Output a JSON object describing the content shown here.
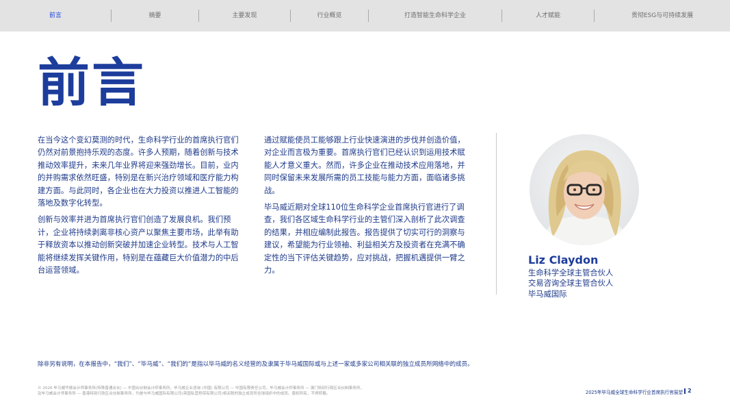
{
  "nav": {
    "items": [
      {
        "label": "前言",
        "active": true
      },
      {
        "label": "摘要"
      },
      {
        "label": "主要发现"
      },
      {
        "label": "行业概览"
      },
      {
        "label": "打造智能生命科学企业"
      },
      {
        "label": "人才赋能"
      },
      {
        "label": "贯彻ESG与可持续发展"
      }
    ]
  },
  "title": "前言",
  "col1": {
    "p1": "在当今这个变幻莫测的时代，生命科学行业的首席执行官们仍然对前景抱持乐观的态度。许多人预期，随着创新与技术推动效率提升，未来几年业界将迎来强劲增长。目前，业内的并购需求依然旺盛，特别是在新兴治疗领域和医疗能力构建方面。与此同时，各企业也在大力投资以推进人工智能的落地及数字化转型。",
    "p2": "创新与效率并进为首席执行官们创造了发展良机。我们预计，企业将持续剥离非核心资产以聚焦主要市场，此举有助于释放资本以推动创新突破并加速企业转型。技术与人工智能将继续发挥关键作用，特别是在蕴藏巨大价值潜力的中后台运营领域。"
  },
  "col2": {
    "p1": "通过赋能使员工能够跟上行业快速演进的步伐并创造价值，对企业而言极为重要。首席执行官们已经认识到运用技术赋能人才意义重大。然而，许多企业在推动技术应用落地，并同时保留未来发展所需的员工技能与能力方面，面临诸多挑战。",
    "p2": "毕马威近期对全球110位生命科学企业首席执行官进行了调查，我们各区域生命科学行业的主管们深入剖析了此次调查的结果，并相应编制此报告。报告提供了切实可行的洞察与建议，希望能为行业领袖、利益相关方及投资者在充满不确定性的当下评估关键趋势，应对挑战，把握机遇提供一臂之力。"
  },
  "person": {
    "name": "Liz Claydon",
    "role1": "生命科学全球主管合伙人",
    "role2": "交易咨询全球主管合伙人",
    "role3": "毕马威国际"
  },
  "note": "除非另有说明，在本报告中，“我们”、“毕马威”、“我们的”是指以毕马威的名义经营的及隶属于毕马威国际或与上述一家或多家公司相关联的独立成员所网络中的成员。",
  "legal": {
    "line1": "© 2026 毕马威华振会计师事务所(特殊普通合伙) — 中国合伙制会计师事务所，毕马威企业咨询 (中国) 有限公司 — 中国有限责任公司，毕马威会计师事务所 — 澳门特别行政区合伙制事务所，",
    "line2": "及毕马威会计师事务所 — 香港特别行政区合伙制事务所，均是与毕马威国际有限公司(英国私营担保有限公司)相关联的独立成员所全球组织中的成员。版权所有，不得转载。"
  },
  "footer": {
    "title": "2025年毕马威全球生命科学行业首席执行官展望",
    "page": "2"
  },
  "colors": {
    "brand_blue": "#1d3d9c",
    "nav_bg": "#e3e3e3",
    "nav_active": "#1e49e2"
  }
}
